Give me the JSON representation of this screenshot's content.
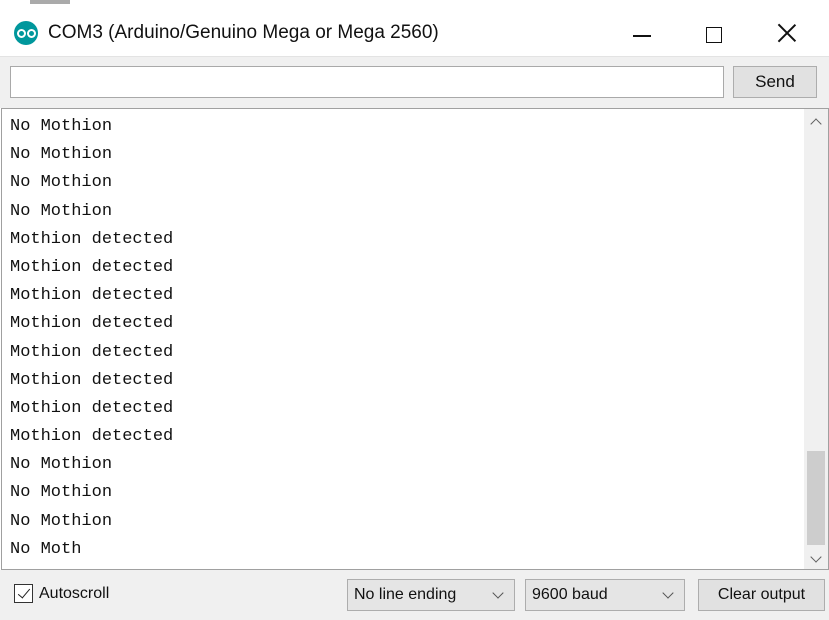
{
  "window": {
    "title": "COM3 (Arduino/Genuino Mega or Mega 2560)",
    "icon": "arduino-logo-icon",
    "accent": "#00979c"
  },
  "send": {
    "input_value": "",
    "button_label": "Send"
  },
  "output": {
    "lines": [
      "No Mothion",
      "No Mothion",
      "No Mothion",
      "No Mothion",
      "Mothion detected",
      "Mothion detected",
      "Mothion detected",
      "Mothion detected",
      "Mothion detected",
      "Mothion detected",
      "Mothion detected",
      "Mothion detected",
      "No Mothion",
      "No Mothion",
      "No Mothion",
      "No Moth"
    ]
  },
  "footer": {
    "autoscroll_label": "Autoscroll",
    "autoscroll_checked": true,
    "line_ending_value": "No line ending",
    "baud_value": "9600 baud",
    "clear_label": "Clear output"
  }
}
